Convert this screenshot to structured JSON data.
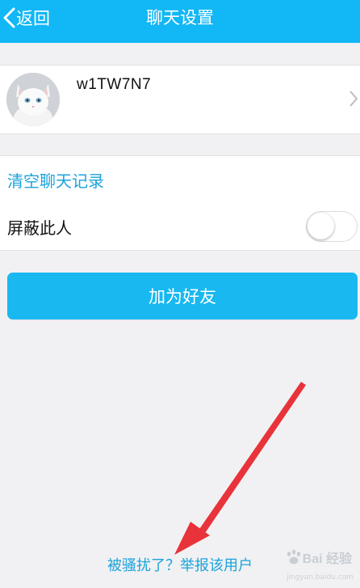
{
  "header": {
    "back_label": "返回",
    "title": "聊天设置"
  },
  "profile": {
    "username": "w1TW7N7"
  },
  "settings": {
    "clear_history_label": "清空聊天记录",
    "block_label": "屏蔽此人",
    "block_enabled": false
  },
  "actions": {
    "add_friend_label": "加为好友",
    "report_label": "被骚扰了？举报该用户"
  },
  "watermark": {
    "logo_text": "Bai 经验",
    "url": "jingyan.baidu.com"
  },
  "colors": {
    "header": "#12b7f5",
    "accent_text": "#1ba3db",
    "button": "#19b8f1",
    "annotation_arrow": "#e8333a",
    "background": "#f1f1f3"
  },
  "icons": [
    "back-chevron-icon",
    "chevron-right-icon",
    "cat-avatar-icon",
    "red-arrow-annotation-icon",
    "baidu-paw-icon"
  ]
}
